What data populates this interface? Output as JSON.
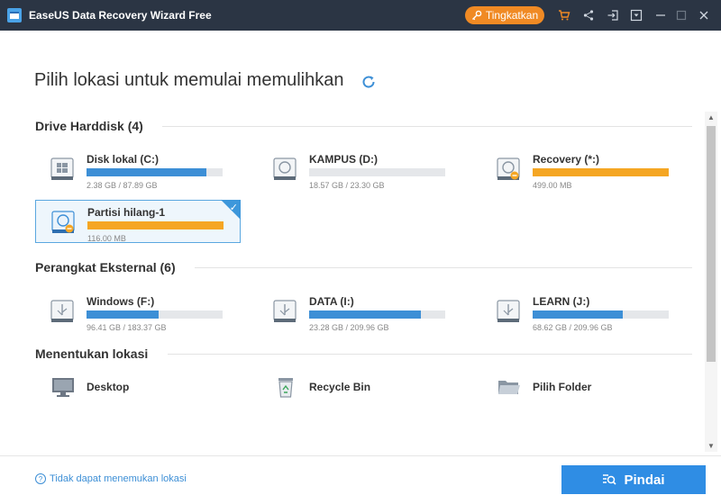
{
  "window": {
    "title": "EaseUS Data Recovery Wizard Free",
    "upgrade_label": "Tingkatkan"
  },
  "main": {
    "heading": "Pilih lokasi untuk memulai memulihkan"
  },
  "sections": {
    "harddisk": {
      "title": "Drive Harddisk (4)",
      "drives": [
        {
          "name": "Disk lokal (C:)",
          "size": "2.38 GB / 87.89 GB",
          "fill_fraction": 0.88,
          "color": "#3d8fd6",
          "icon": "windows-drive-icon"
        },
        {
          "name": "KAMPUS (D:)",
          "size": "18.57 GB / 23.30 GB",
          "fill_fraction": 0.0,
          "color": "#3d8fd6",
          "icon": "hard-drive-icon"
        },
        {
          "name": "Recovery (*:)",
          "size": "499.00 MB",
          "fill_fraction": 1.0,
          "color": "#f5a623",
          "icon": "hidden-drive-icon"
        },
        {
          "name": "Partisi hilang-1",
          "size": "116.00 MB",
          "fill_fraction": 1.0,
          "color": "#f5a623",
          "icon": "lost-partition-icon",
          "selected": true
        }
      ]
    },
    "external": {
      "title": "Perangkat Eksternal (6)",
      "drives": [
        {
          "name": "Windows (F:)",
          "size": "96.41 GB / 183.37 GB",
          "fill_fraction": 0.53,
          "color": "#3d8fd6",
          "icon": "usb-drive-icon"
        },
        {
          "name": "DATA (I:)",
          "size": "23.28 GB / 209.96 GB",
          "fill_fraction": 0.82,
          "color": "#3d8fd6",
          "icon": "usb-drive-icon"
        },
        {
          "name": "LEARN (J:)",
          "size": "68.62 GB / 209.96 GB",
          "fill_fraction": 0.66,
          "color": "#3d8fd6",
          "icon": "usb-drive-icon"
        }
      ]
    },
    "locations": {
      "title": "Menentukan lokasi",
      "items": [
        {
          "name": "Desktop",
          "icon": "desktop-icon"
        },
        {
          "name": "Recycle Bin",
          "icon": "recycle-bin-icon"
        },
        {
          "name": "Pilih Folder",
          "icon": "folder-icon"
        }
      ]
    }
  },
  "footer": {
    "help_text": "Tidak dapat menemukan lokasi",
    "scan_label": "Pindai"
  },
  "colors": {
    "titlebar": "#2b3544",
    "accent_blue": "#3d8fd6",
    "accent_orange": "#f08a24",
    "scan_button": "#2f8de4"
  }
}
